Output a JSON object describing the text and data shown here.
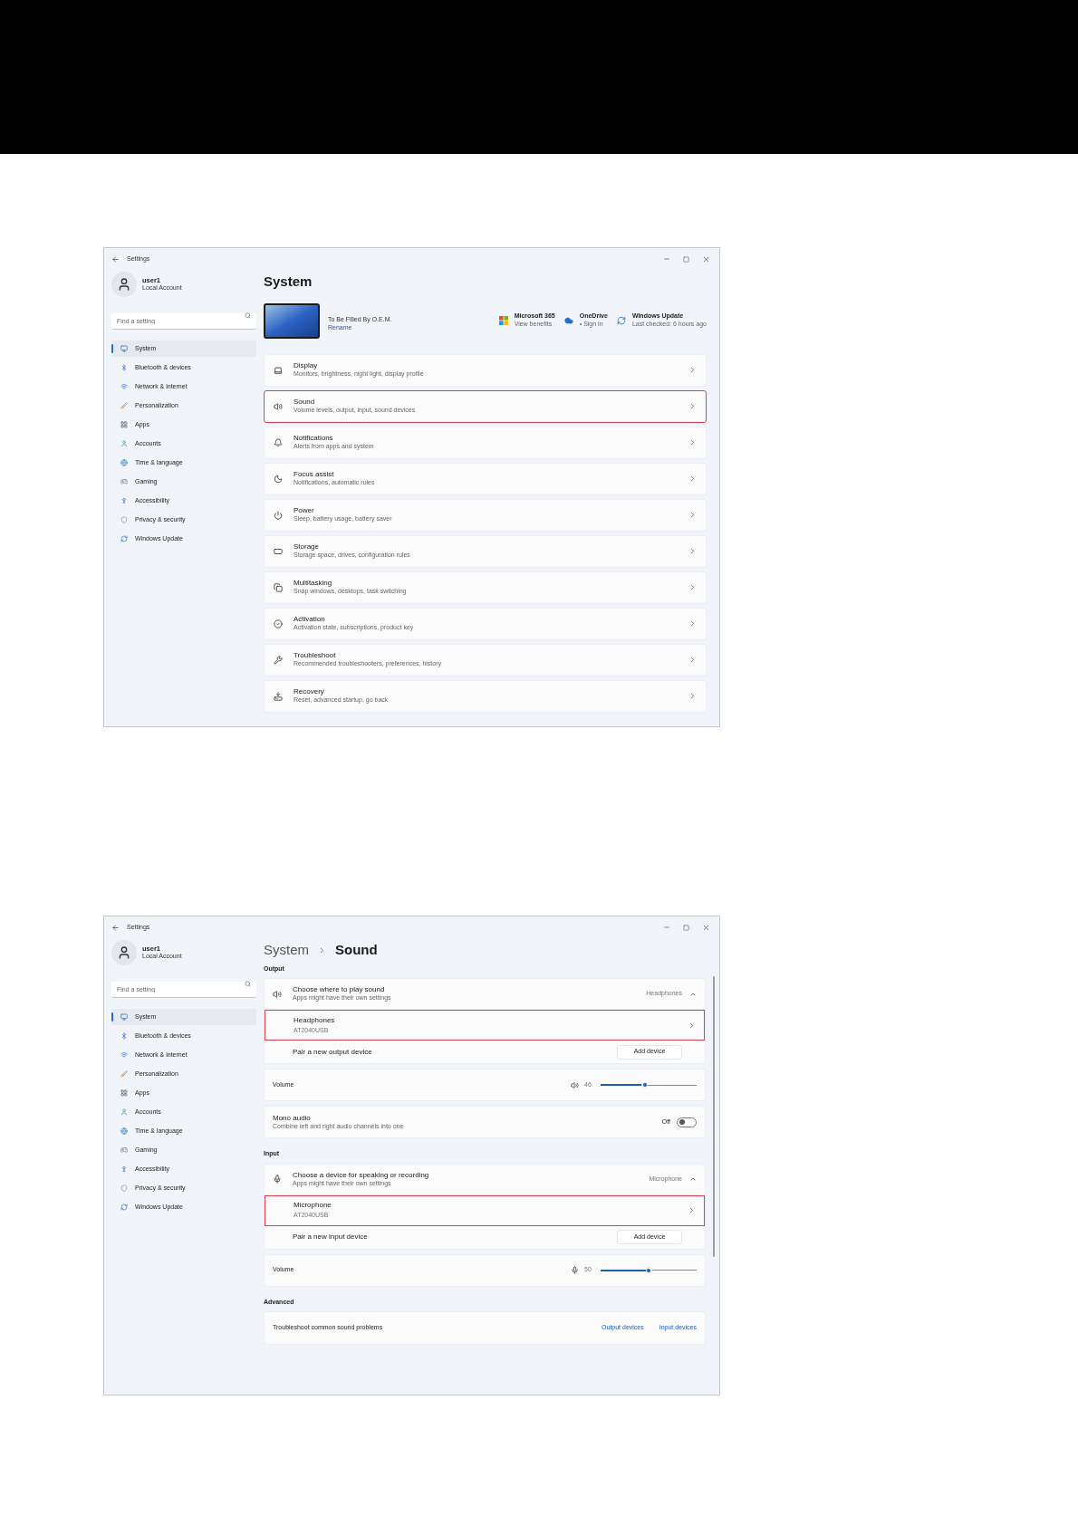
{
  "windows": [
    {
      "kind": "system",
      "title": "Settings",
      "user": {
        "name": "user1",
        "account": "Local Account"
      },
      "search": {
        "placeholder": "Find a setting"
      },
      "nav": [
        {
          "label": "System",
          "selected": true
        },
        {
          "label": "Bluetooth & devices",
          "selected": false
        },
        {
          "label": "Network & internet",
          "selected": false
        },
        {
          "label": "Personalization",
          "selected": false
        },
        {
          "label": "Apps",
          "selected": false
        },
        {
          "label": "Accounts",
          "selected": false
        },
        {
          "label": "Time & language",
          "selected": false
        },
        {
          "label": "Gaming",
          "selected": false
        },
        {
          "label": "Accessibility",
          "selected": false
        },
        {
          "label": "Privacy & security",
          "selected": false
        },
        {
          "label": "Windows Update",
          "selected": false
        }
      ],
      "heading": "System",
      "device": {
        "model": "To Be Filled By O.E.M.",
        "link": "Rename"
      },
      "tiles": [
        {
          "title": "Microsoft 365",
          "subtitle": "View benefits"
        },
        {
          "title": "OneDrive",
          "subtitle": "• Sign in"
        },
        {
          "title": "Windows Update",
          "subtitle": "Last checked: 6 hours ago"
        }
      ],
      "rows": [
        {
          "title": "Display",
          "subtitle": "Monitors, brightness, night light, display profile",
          "highlighted": false
        },
        {
          "title": "Sound",
          "subtitle": "Volume levels, output, input, sound devices",
          "highlighted": true
        },
        {
          "title": "Notifications",
          "subtitle": "Alerts from apps and system",
          "highlighted": false
        },
        {
          "title": "Focus assist",
          "subtitle": "Notifications, automatic rules",
          "highlighted": false
        },
        {
          "title": "Power",
          "subtitle": "Sleep, battery usage, battery saver",
          "highlighted": false
        },
        {
          "title": "Storage",
          "subtitle": "Storage space, drives, configuration rules",
          "highlighted": false
        },
        {
          "title": "Multitasking",
          "subtitle": "Snap windows, desktops, task switching",
          "highlighted": false
        },
        {
          "title": "Activation",
          "subtitle": "Activation state, subscriptions, product key",
          "highlighted": false
        },
        {
          "title": "Troubleshoot",
          "subtitle": "Recommended troubleshooters, preferences, history",
          "highlighted": false
        },
        {
          "title": "Recovery",
          "subtitle": "Reset, advanced startup, go back",
          "highlighted": false
        }
      ]
    },
    {
      "kind": "sound",
      "title": "Settings",
      "user": {
        "name": "user1",
        "account": "Local Account"
      },
      "search": {
        "placeholder": "Find a setting"
      },
      "nav": [
        {
          "label": "System",
          "selected": true
        },
        {
          "label": "Bluetooth & devices",
          "selected": false
        },
        {
          "label": "Network & internet",
          "selected": false
        },
        {
          "label": "Personalization",
          "selected": false
        },
        {
          "label": "Apps",
          "selected": false
        },
        {
          "label": "Accounts",
          "selected": false
        },
        {
          "label": "Time & language",
          "selected": false
        },
        {
          "label": "Gaming",
          "selected": false
        },
        {
          "label": "Accessibility",
          "selected": false
        },
        {
          "label": "Privacy & security",
          "selected": false
        },
        {
          "label": "Windows Update",
          "selected": false
        }
      ],
      "breadcrumb": [
        "System",
        "Sound"
      ],
      "sections": [
        {
          "label": "Output",
          "cards": [
            {
              "rows": [
                {
                  "kind": "expander",
                  "title": "Choose where to play sound",
                  "subtitle": "Apps might have their own settings",
                  "value": "Headphones",
                  "expanded": true
                },
                {
                  "kind": "device",
                  "title": "Headphones",
                  "subtitle": "AT2040USB",
                  "highlighted": true
                },
                {
                  "kind": "pair",
                  "label": "Pair a new output device",
                  "button": "Add device"
                }
              ]
            },
            {
              "rows": [
                {
                  "kind": "volume",
                  "label": "Volume",
                  "reading": "46",
                  "level": 0.46
                }
              ]
            },
            {
              "rows": [
                {
                  "kind": "toggle",
                  "title": "Mono audio",
                  "subtitle": "Combine left and right audio channels into one",
                  "state_label": "Off",
                  "on": false
                }
              ]
            }
          ]
        },
        {
          "label": "Input",
          "cards": [
            {
              "rows": [
                {
                  "kind": "expander",
                  "title": "Choose a device for speaking or recording",
                  "subtitle": "Apps might have their own settings",
                  "value": "Microphone",
                  "expanded": true
                },
                {
                  "kind": "device",
                  "title": "Microphone",
                  "subtitle": "AT2040USB",
                  "highlighted": true
                },
                {
                  "kind": "pair",
                  "label": "Pair a new input device",
                  "button": "Add device"
                }
              ]
            },
            {
              "rows": [
                {
                  "kind": "volume",
                  "label": "Volume",
                  "reading": "50",
                  "level": 0.5
                }
              ]
            }
          ]
        },
        {
          "label": "Advanced",
          "cards": [
            {
              "rows": [
                {
                  "kind": "links",
                  "label": "Troubleshoot common sound problems",
                  "links": [
                    "Output devices",
                    "Input devices"
                  ]
                }
              ]
            }
          ]
        }
      ]
    }
  ]
}
